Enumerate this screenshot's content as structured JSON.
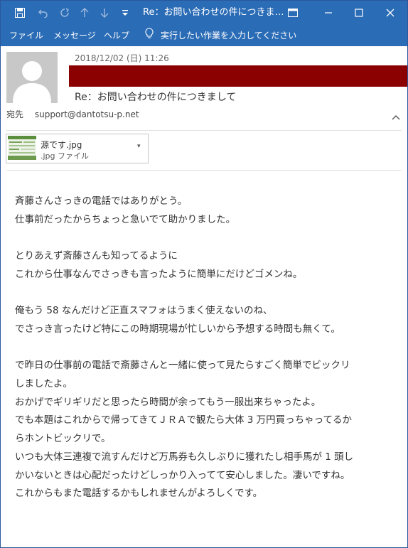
{
  "window": {
    "title": "Re：お問い合わせの件につきま…",
    "controls": {
      "ribbon_display": "ribbon-display-icon",
      "minimize": "minimize-icon",
      "maximize": "maximize-icon",
      "close": "close-icon"
    }
  },
  "quick_access": [
    "save-icon",
    "undo-icon",
    "redo-icon",
    "up-icon",
    "down-icon",
    "customize-icon"
  ],
  "menu": {
    "file": "ファイル",
    "message": "メッセージ",
    "help": "ヘルプ",
    "tell_me": "実行したい作業を入力してください"
  },
  "email": {
    "date": "2018/12/02 (日) 11:26",
    "subject": "Re：お問い合わせの件につきまして",
    "to_label": "宛先",
    "to_address": "support@dantotsu-p.net",
    "sender_redacted_color": "#8b0000"
  },
  "attachment": {
    "name": "源です.jpg",
    "type": ".jpg ファイル"
  },
  "body": {
    "p1": [
      "斉藤さんさっきの電話ではありがとう。",
      "仕事前だったからちょっと急いでて助かりました。"
    ],
    "p2": [
      "とりあえず斎藤さんも知ってるように",
      "これから仕事なんでさっきも言ったように簡単にだけどゴメンね。"
    ],
    "p3": [
      "俺もう 58 なんだけど正直スマフォはうまく使えないのね、",
      "でさっき言ったけど特にこの時期現場が忙しいから予想する時間も無くて。"
    ],
    "p4": [
      "で昨日の仕事前の電話で斎藤さんと一緒に使って見たらすごく簡単でビックリ",
      "しましたよ。",
      "おかげでギリギリだと思ったら時間が余ってもう一服出来ちゃったよ。",
      "でも本題はこれからで帰ってきてＪＲＡで観たら大体 3 万円買っちゃってるか",
      "らホントビックリで。",
      "いつも大体三連複で流すんだけど万馬券も久しぶりに獲れたし相手馬が 1 頭し",
      "かいないときは心配だったけどしっかり入ってて安心しました。凄いですね。",
      "これからもまた電話するかもしれませんがよろしくです。"
    ]
  },
  "colors": {
    "title_bar": "#2b6cb6",
    "accent": "#2b579a"
  }
}
